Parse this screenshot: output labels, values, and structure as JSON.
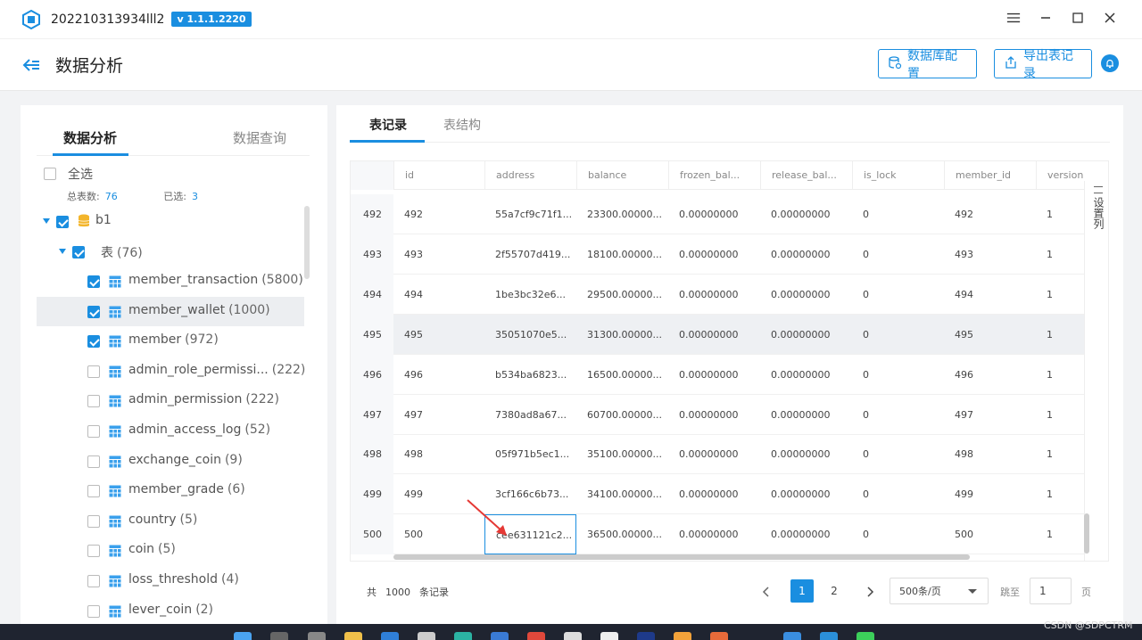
{
  "app": {
    "title": "202210313934lll2",
    "version": "v 1.1.1.2220"
  },
  "header": {
    "page_title": "数据分析",
    "db_config_label": "数据库配置",
    "export_label": "导出表记录"
  },
  "left": {
    "tabs": [
      "数据分析",
      "数据查询"
    ],
    "select_all_label": "全选",
    "stats": {
      "total_label": "总表数:",
      "total_value": "76",
      "selected_label": "已选:",
      "selected_value": "3"
    },
    "db_name": "b1",
    "group_label": "表",
    "group_count": "(76)",
    "tables": [
      {
        "name": "member_transaction",
        "count": "(5800)",
        "checked": true
      },
      {
        "name": "member_wallet",
        "count": "(1000)",
        "checked": true
      },
      {
        "name": "member",
        "count": "(972)",
        "checked": true
      },
      {
        "name": "admin_role_permissi...",
        "count": "(222)",
        "checked": false
      },
      {
        "name": "admin_permission",
        "count": "(222)",
        "checked": false
      },
      {
        "name": "admin_access_log",
        "count": "(52)",
        "checked": false
      },
      {
        "name": "exchange_coin",
        "count": "(9)",
        "checked": false
      },
      {
        "name": "member_grade",
        "count": "(6)",
        "checked": false
      },
      {
        "name": "country",
        "count": "(5)",
        "checked": false
      },
      {
        "name": "coin",
        "count": "(5)",
        "checked": false
      },
      {
        "name": "loss_threshold",
        "count": "(4)",
        "checked": false
      },
      {
        "name": "lever_coin",
        "count": "(2)",
        "checked": false
      }
    ]
  },
  "right": {
    "tabs": [
      "表记录",
      "表结构"
    ],
    "columns": [
      "id",
      "address",
      "balance",
      "frozen_bal...",
      "release_bal...",
      "is_lock",
      "member_id",
      "version"
    ],
    "rows": [
      [
        "492",
        "492",
        "55a7cf9c71f1...",
        "23300.00000...",
        "0.00000000",
        "0.00000000",
        "0",
        "492",
        "1"
      ],
      [
        "493",
        "493",
        "2f55707d419...",
        "18100.00000...",
        "0.00000000",
        "0.00000000",
        "0",
        "493",
        "1"
      ],
      [
        "494",
        "494",
        "1be3bc32e6...",
        "29500.00000...",
        "0.00000000",
        "0.00000000",
        "0",
        "494",
        "1"
      ],
      [
        "495",
        "495",
        "35051070e5...",
        "31300.00000...",
        "0.00000000",
        "0.00000000",
        "0",
        "495",
        "1"
      ],
      [
        "496",
        "496",
        "b534ba6823...",
        "16500.00000...",
        "0.00000000",
        "0.00000000",
        "0",
        "496",
        "1"
      ],
      [
        "497",
        "497",
        "7380ad8a67...",
        "60700.00000...",
        "0.00000000",
        "0.00000000",
        "0",
        "497",
        "1"
      ],
      [
        "498",
        "498",
        "05f971b5ec1...",
        "35100.00000...",
        "0.00000000",
        "0.00000000",
        "0",
        "498",
        "1"
      ],
      [
        "499",
        "499",
        "3cf166c6b73...",
        "34100.00000...",
        "0.00000000",
        "0.00000000",
        "0",
        "499",
        "1"
      ],
      [
        "500",
        "500",
        "cee631121c2...",
        "36500.00000...",
        "0.00000000",
        "0.00000000",
        "0",
        "500",
        "1"
      ]
    ],
    "side_settings": "设置列",
    "footer": {
      "total_prefix": "共",
      "total_count": "1000",
      "total_suffix": "条记录",
      "pages": [
        "1",
        "2"
      ],
      "page_size": "500条/页",
      "goto_label": "跳至",
      "goto_value": "1",
      "page_unit": "页"
    }
  },
  "watermark": "CSDN @SDPCTRM",
  "colors": {
    "accent": "#1a8ee0"
  }
}
